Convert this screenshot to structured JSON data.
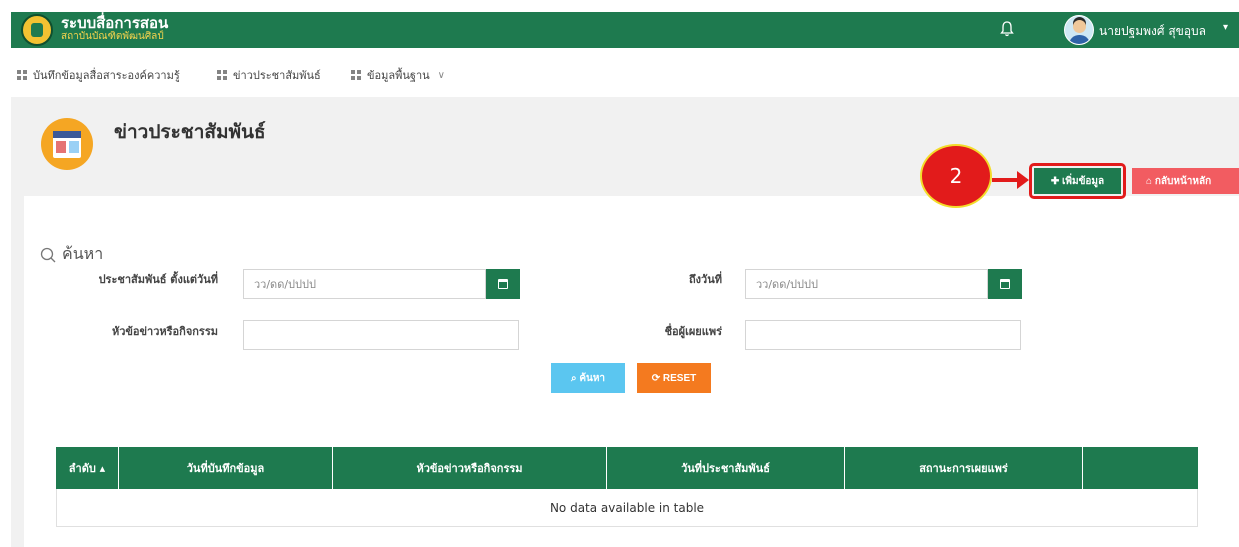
{
  "header": {
    "title": "ระบบสื่อการสอน",
    "subtitle": "สถาบันบัณฑิตพัฒนศิลป์",
    "user_name": "นายปฐมพงศ์ สุขอุบล",
    "caret": "▾"
  },
  "nav": {
    "items": [
      {
        "label": "บันทึกข้อมูลสื่อสาระองค์ความรู้"
      },
      {
        "label": "ข่าวประชาสัมพันธ์"
      },
      {
        "label": "ข้อมูลพื้นฐาน"
      }
    ],
    "dropdown_caret": "∨"
  },
  "page": {
    "title": "ข่าวประชาสัมพันธ์",
    "news_badge": "NEWS"
  },
  "callout": {
    "step_number": "2"
  },
  "actions": {
    "add_label": "✚ เพิ่มข้อมูล",
    "home_label": "⌂ กลับหน้าหลัก"
  },
  "search": {
    "heading": "ค้นหา",
    "from_date_label": "ประชาสัมพันธ์ ตั้งแต่วันที่",
    "from_date_placeholder": "วว/ดด/ปปปป",
    "to_date_label": "ถึงวันที่",
    "to_date_placeholder": "วว/ดด/ปปปป",
    "topic_label": "หัวข้อข่าวหรือกิจกรรม",
    "topic_value": "",
    "publisher_label": "ชื่อผู้เผยแพร่",
    "publisher_value": "",
    "search_button": "⌕ ค้นหา",
    "reset_button": "⟳ RESET"
  },
  "table": {
    "columns": [
      {
        "label": "ลำดับ ▴"
      },
      {
        "label": "วันที่บันทึกข้อมูล"
      },
      {
        "label": "หัวข้อข่าวหรือกิจกรรม"
      },
      {
        "label": "วันที่ประชาสัมพันธ์"
      },
      {
        "label": "สถานะการเผยแพร่"
      },
      {
        "label": ""
      }
    ],
    "empty_message": "No data available in table"
  },
  "colors": {
    "primary_green": "#1e7a4f",
    "callout_red": "#e21b1b",
    "home_button": "#f25c61",
    "search_button": "#5bc6f0",
    "reset_button": "#f47a1f"
  }
}
